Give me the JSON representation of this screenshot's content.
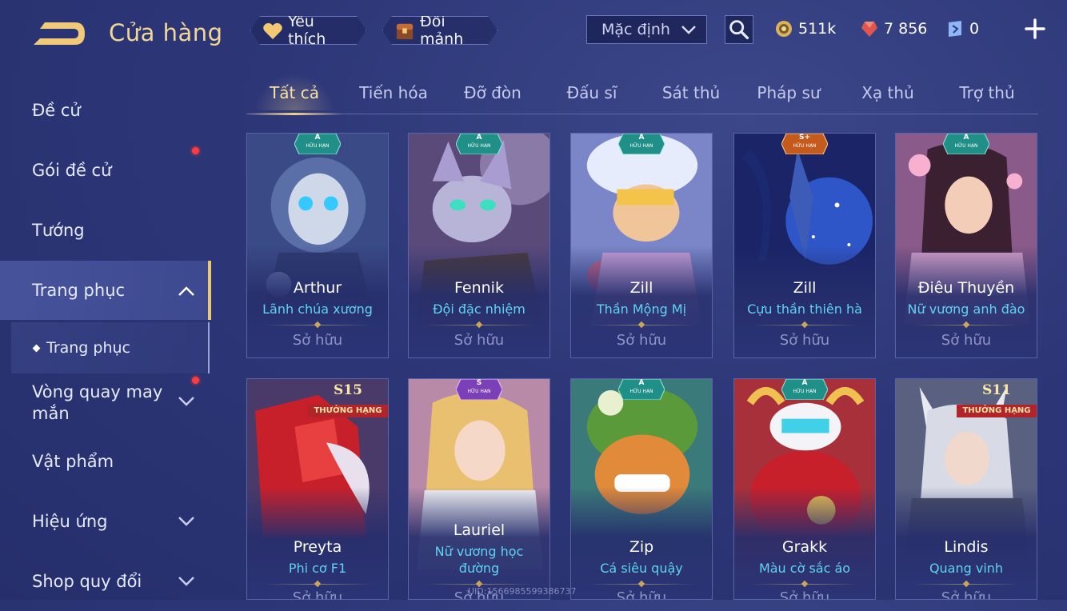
{
  "header": {
    "title": "Cửa hàng",
    "favorite_label": "Yêu thích",
    "fragment_label": "Đổi mảnh",
    "sort_value": "Mặc định",
    "currencies": {
      "gold": "511k",
      "ruby": "7 856",
      "voucher": "0"
    }
  },
  "sidebar": {
    "items": [
      {
        "label": "Đề cử"
      },
      {
        "label": "Gói đề cử"
      },
      {
        "label": "Tướng"
      },
      {
        "label": "Trang phục"
      },
      {
        "label": "Trang phục"
      },
      {
        "label": "Vòng quay may mắn"
      },
      {
        "label": "Vật phẩm"
      },
      {
        "label": "Hiệu ứng"
      },
      {
        "label": "Shop quy đổi"
      }
    ]
  },
  "tabs": [
    {
      "label": "Tất cả"
    },
    {
      "label": "Tiến hóa"
    },
    {
      "label": "Đỡ đòn"
    },
    {
      "label": "Đấu sĩ"
    },
    {
      "label": "Sát thủ"
    },
    {
      "label": "Pháp sư"
    },
    {
      "label": "Xạ thủ"
    },
    {
      "label": "Trợ thủ"
    }
  ],
  "cards": [
    {
      "hero": "Arthur",
      "skin": "Lãnh chúa xương",
      "status": "Sở hữu",
      "rank": "A",
      "rank_sub": "HỮU HẠN"
    },
    {
      "hero": "Fennik",
      "skin": "Đội đặc nhiệm",
      "status": "Sở hữu",
      "rank": "A",
      "rank_sub": "HỮU HẠN"
    },
    {
      "hero": "Zill",
      "skin": "Thần Mộng Mị",
      "status": "Sở hữu",
      "rank": "A",
      "rank_sub": "HỮU HẠN"
    },
    {
      "hero": "Zill",
      "skin": "Cựu thần thiên hà",
      "status": "Sở hữu",
      "rank": "S+",
      "rank_sub": "HỮU HẠN"
    },
    {
      "hero": "Điêu Thuyền",
      "skin": "Nữ vương anh đào",
      "status": "Sở hữu",
      "rank": "A",
      "rank_sub": "HỮU HẠN"
    },
    {
      "hero": "Preyta",
      "skin": "Phi cơ F1",
      "status": "Sở hữu",
      "season": "S15",
      "season_tag": "THƯỞNG HẠNG"
    },
    {
      "hero": "Lauriel",
      "skin": "Nữ vương học đường",
      "status": "Sở hữu",
      "rank": "S",
      "rank_sub": "HỮU HẠN"
    },
    {
      "hero": "Zip",
      "skin": "Cá siêu quậy",
      "status": "Sở hữu",
      "rank": "A",
      "rank_sub": "HỮU HẠN"
    },
    {
      "hero": "Grakk",
      "skin": "Màu cờ sắc áo",
      "status": "Sở hữu",
      "rank": "A",
      "rank_sub": "HỮU HẠN"
    },
    {
      "hero": "Lindis",
      "skin": "Quang vinh",
      "status": "Sở hữu",
      "season": "S11",
      "season_tag": "THƯỞNG HẠNG"
    }
  ],
  "footer": {
    "uid": "UID:1566985599386737"
  },
  "colors": {
    "accent_gold": "#f3d795",
    "skin_name": "#5fd3f2",
    "rank_a": "#1f8f88",
    "rank_s": "#7b3fb8",
    "rank_splus": "#c45a1c",
    "season_red": "#b0242a"
  }
}
